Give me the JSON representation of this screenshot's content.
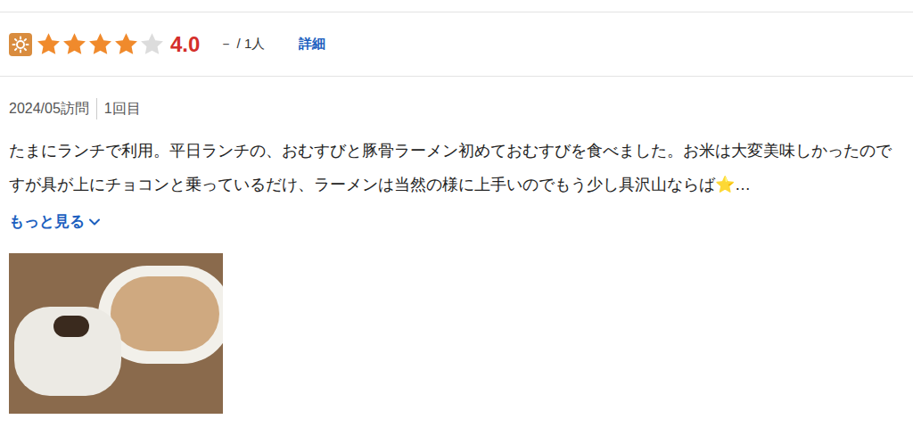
{
  "rating": {
    "stars": 4,
    "score": "4.0",
    "count": "－ / 1人",
    "detail_link": "詳細"
  },
  "visit": {
    "date": "2024/05訪問",
    "count": "1回目"
  },
  "review": {
    "text": "たまにランチで利用。平日ランチの、おむすびと豚骨ラーメン初めておむすびを食べました。お米は大変美味しかったのですが具が上にチョコンと乗っているだけ、ラーメンは当然の様に上手いのでもう少し具沢山ならば⭐…",
    "more_link": "もっと見る"
  }
}
